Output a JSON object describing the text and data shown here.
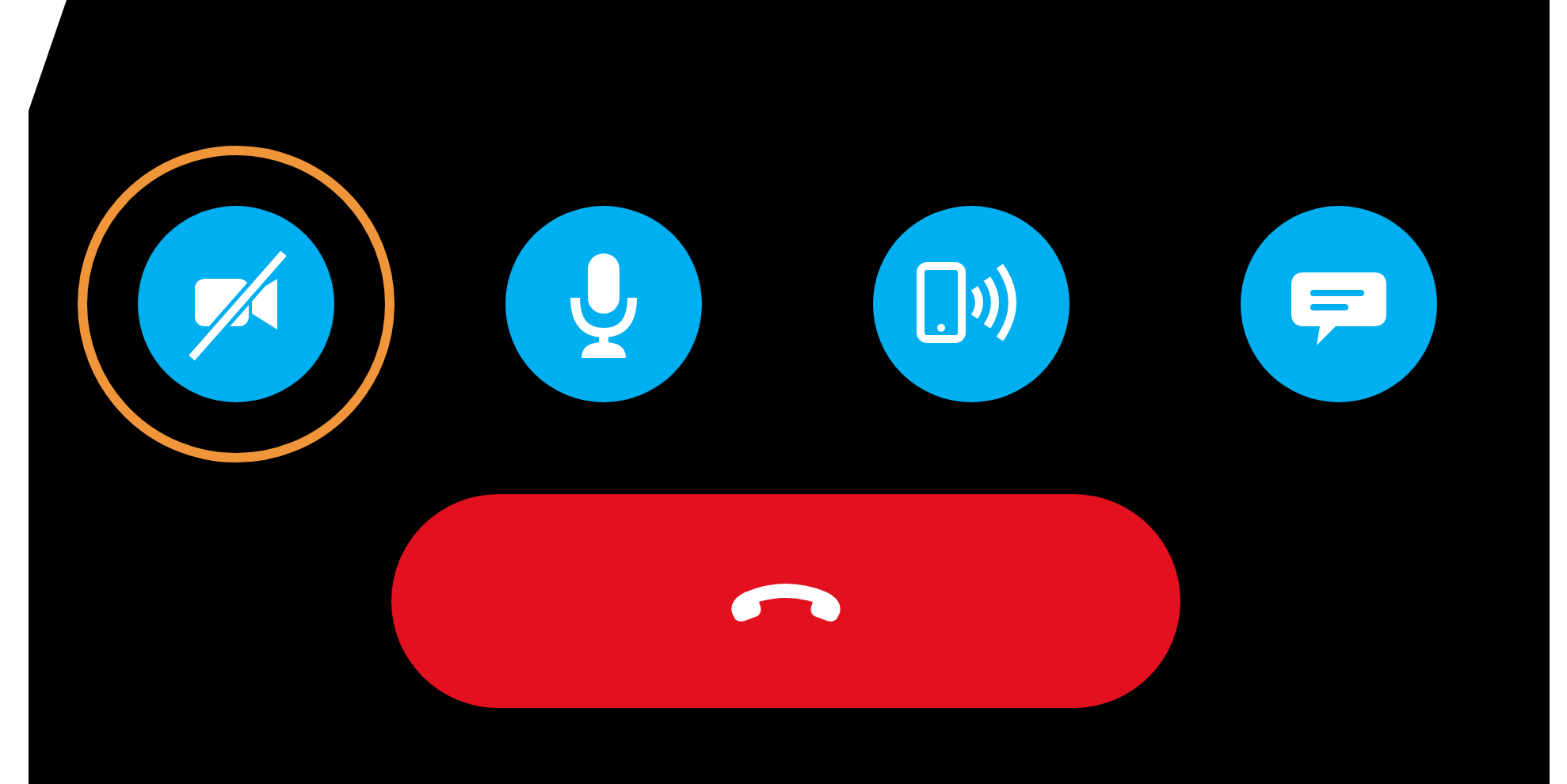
{
  "controls": [
    {
      "kind": "camera",
      "on": false,
      "focused": true
    },
    {
      "kind": "microphone",
      "on": true,
      "focused": false
    },
    {
      "kind": "speaker",
      "on": true,
      "focused": false
    },
    {
      "kind": "chat",
      "on": true,
      "focused": false
    }
  ],
  "end_call": {
    "kind": "hang-up"
  }
}
